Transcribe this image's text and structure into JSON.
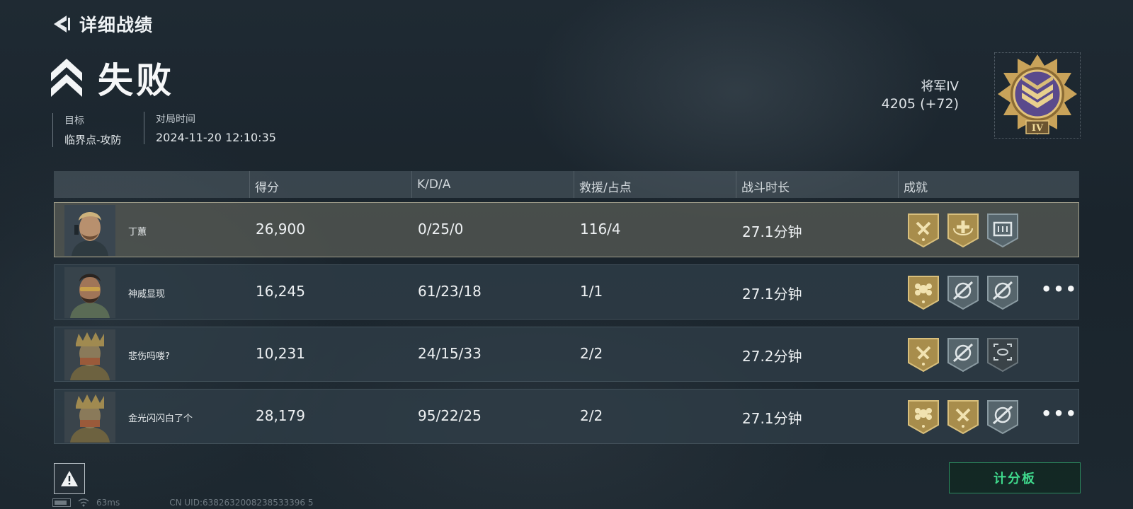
{
  "header": {
    "title": "详细战绩",
    "result": "失败"
  },
  "match": {
    "target_label": "目标",
    "target_value": "临界点-攻防",
    "time_label": "对局时间",
    "time_value": "2024-11-20 12:10:35"
  },
  "rank": {
    "name": "将军IV",
    "points": "4205 (+72)",
    "emblem_numeral": "IV"
  },
  "table": {
    "columns": [
      "得分",
      "K/D/A",
      "救援/占点",
      "战斗时长",
      "成就"
    ],
    "rows": [
      {
        "name": "丁蕙",
        "score": "26,900",
        "kda": "0/25/0",
        "rescue": "116/4",
        "time": "27.1分钟",
        "self": true,
        "more": "",
        "badges": [
          "gold-hammer-icon",
          "gold-medic-icon",
          "grey-box-icon"
        ]
      },
      {
        "name": "神威显现",
        "score": "16,245",
        "kda": "61/23/18",
        "rescue": "1/1",
        "time": "27.1分钟",
        "self": false,
        "more": "•••",
        "badges": [
          "gold-flower-icon",
          "grey-sniper-icon",
          "grey-sniper-icon"
        ]
      },
      {
        "name": "悲伤吗喽?",
        "score": "10,231",
        "kda": "24/15/33",
        "rescue": "2/2",
        "time": "27.2分钟",
        "self": false,
        "more": "",
        "badges": [
          "gold-hammer-icon",
          "grey-sniper-icon",
          "dark-scan-icon"
        ]
      },
      {
        "name": "金光闪闪白了个",
        "score": "28,179",
        "kda": "95/22/25",
        "rescue": "2/2",
        "time": "27.1分钟",
        "self": false,
        "more": "•••",
        "badges": [
          "gold-flower-icon",
          "gold-hammer-icon",
          "grey-sniper-icon"
        ]
      }
    ]
  },
  "footer": {
    "scoreboard_label": "计分板",
    "ping": "63ms",
    "uid": "CN UID:6382632008238533396 5"
  },
  "colors": {
    "accent_green": "#3fd98c",
    "gold_badge": "#b89a52",
    "grey_badge": "#5e6d73"
  }
}
